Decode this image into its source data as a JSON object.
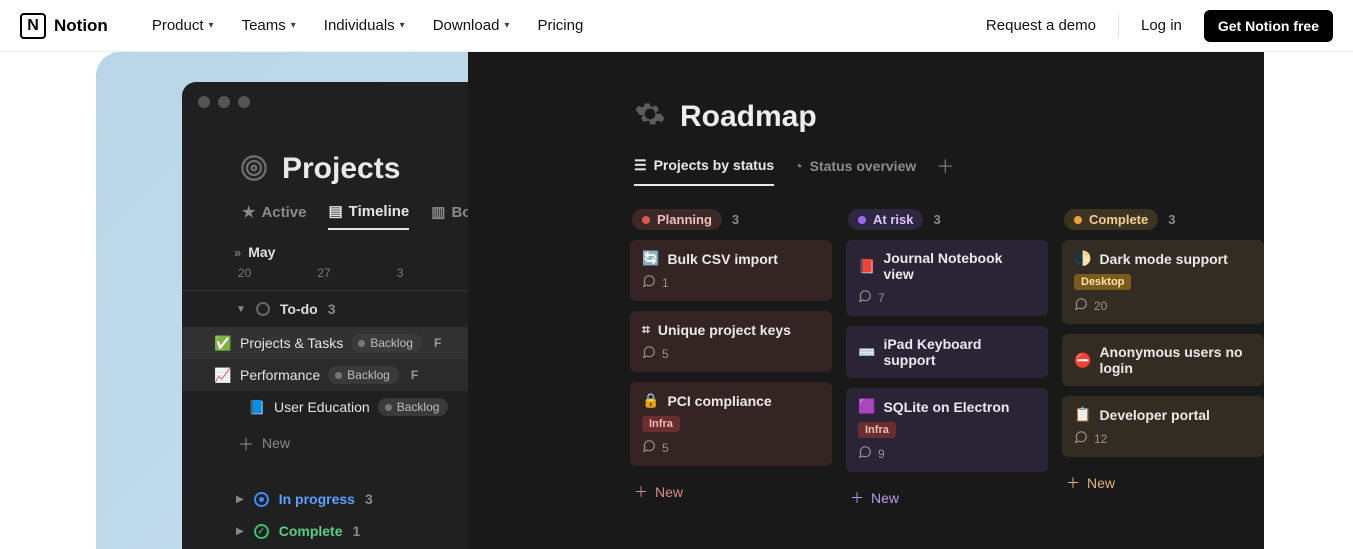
{
  "nav": {
    "brand": "Notion",
    "items": [
      "Product",
      "Teams",
      "Individuals",
      "Download",
      "Pricing"
    ],
    "request_demo": "Request a demo",
    "login": "Log in",
    "cta": "Get Notion free"
  },
  "left_panel": {
    "title": "Projects",
    "tabs": {
      "active": "Active",
      "timeline": "Timeline",
      "board": "Board"
    },
    "month": "May",
    "dates": [
      "20",
      "27",
      "3"
    ],
    "todo": {
      "label": "To-do",
      "count": "3"
    },
    "tasks": [
      {
        "emoji": "✅",
        "name": "Projects & Tasks",
        "pill": "Backlog",
        "letter": "F"
      },
      {
        "emoji": "📈",
        "name": "Performance",
        "pill": "Backlog",
        "letter": "F"
      },
      {
        "emoji": "📘",
        "name": "User Education",
        "pill": "Backlog",
        "letter": ""
      }
    ],
    "new_label": "New",
    "in_progress": {
      "label": "In progress",
      "count": "3"
    },
    "complete": {
      "label": "Complete",
      "count": "1"
    }
  },
  "roadmap": {
    "title": "Roadmap",
    "tabs": {
      "by_status": "Projects by status",
      "overview": "Status overview"
    },
    "columns": {
      "planning": {
        "label": "Planning",
        "count": "3",
        "new": "New",
        "cards": [
          {
            "emoji": "🔄",
            "title": "Bulk CSV import",
            "comments": "1",
            "tag": ""
          },
          {
            "emoji": "⌗",
            "title": "Unique project keys",
            "comments": "5",
            "tag": ""
          },
          {
            "emoji": "🔒",
            "title": "PCI compliance",
            "comments": "5",
            "tag": "Infra"
          }
        ]
      },
      "atrisk": {
        "label": "At risk",
        "count": "3",
        "new": "New",
        "cards": [
          {
            "emoji": "📕",
            "title": "Journal Notebook view",
            "comments": "7",
            "tag": ""
          },
          {
            "emoji": "⌨️",
            "title": "iPad Keyboard support",
            "comments": "",
            "tag": ""
          },
          {
            "emoji": "🟪",
            "title": "SQLite on Electron",
            "comments": "9",
            "tag": "Infra"
          }
        ]
      },
      "complete": {
        "label": "Complete",
        "count": "3",
        "new": "New",
        "cards": [
          {
            "emoji": "🌓",
            "title": "Dark mode support",
            "comments": "20",
            "tag": "Desktop"
          },
          {
            "emoji": "⛔",
            "title": "Anonymous users no login",
            "comments": "",
            "tag": ""
          },
          {
            "emoji": "📋",
            "title": "Developer portal",
            "comments": "12",
            "tag": ""
          }
        ]
      }
    }
  }
}
